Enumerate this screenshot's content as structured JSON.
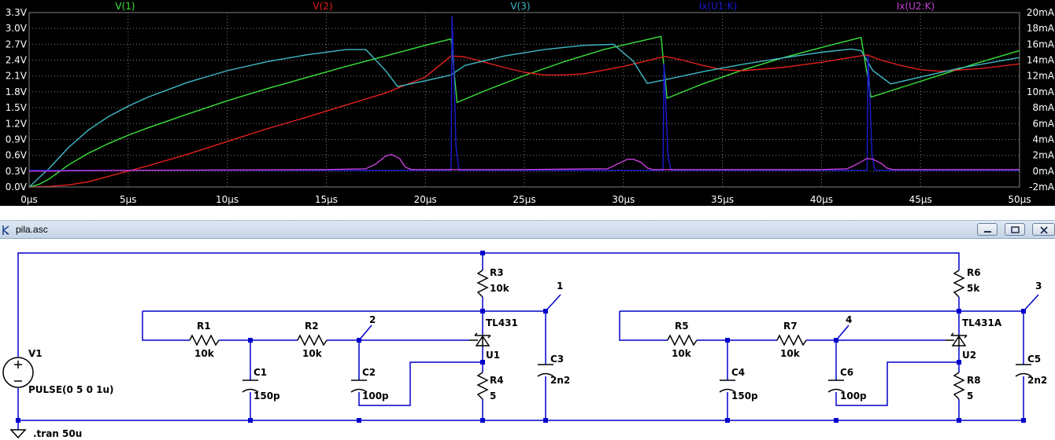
{
  "window_title": "pila.asc",
  "colors": {
    "plot_bg": "#000000",
    "grid": "#7f7f7f",
    "axis_text": "#ffffff",
    "v1": "#39e23a",
    "v2": "#e5201c",
    "v3": "#3fb9c9",
    "ix_u1k": "#1b1bd6",
    "ix_u2k": "#c43fd6",
    "wire": "#0000cc",
    "component": "#000000"
  },
  "chart_data": {
    "type": "line",
    "x_label": "",
    "xlim": [
      0,
      50
    ],
    "x_ticks": [
      "0µs",
      "5µs",
      "10µs",
      "15µs",
      "20µs",
      "25µs",
      "30µs",
      "35µs",
      "40µs",
      "45µs",
      "50µs"
    ],
    "y_left_lim": [
      0,
      3.3
    ],
    "y_left_ticks": [
      "3.3V",
      "3.0V",
      "2.7V",
      "2.4V",
      "2.1V",
      "1.8V",
      "1.5V",
      "1.2V",
      "0.9V",
      "0.6V",
      "0.3V",
      "0.0V"
    ],
    "y_right_lim": [
      -2,
      20
    ],
    "y_right_ticks": [
      "20mA",
      "18mA",
      "16mA",
      "14mA",
      "12mA",
      "10mA",
      "8mA",
      "6mA",
      "4mA",
      "2mA",
      "0mA",
      "-2mA"
    ],
    "grid": true,
    "series": [
      {
        "name": "V(1)",
        "axis": "left",
        "color": "#39e23a",
        "x": [
          0,
          0.5,
          1,
          2,
          3,
          4,
          5,
          6,
          8,
          10,
          12,
          14,
          16,
          18,
          20,
          21.3,
          21.6,
          23,
          25,
          27,
          29,
          31.9,
          32.2,
          34,
          36,
          38,
          40,
          42,
          42.5,
          44,
          46,
          48,
          50
        ],
        "y": [
          0,
          0.05,
          0.15,
          0.42,
          0.64,
          0.82,
          0.98,
          1.12,
          1.38,
          1.63,
          1.86,
          2.07,
          2.28,
          2.48,
          2.68,
          2.8,
          1.6,
          1.82,
          2.11,
          2.37,
          2.6,
          2.85,
          1.68,
          1.95,
          2.21,
          2.44,
          2.64,
          2.83,
          1.7,
          1.88,
          2.12,
          2.36,
          2.58
        ]
      },
      {
        "name": "V(2)",
        "axis": "left",
        "color": "#e5201c",
        "x": [
          0,
          1,
          2,
          3,
          4,
          5,
          6,
          8,
          10,
          12,
          14,
          16,
          18,
          20,
          21.3,
          22,
          23,
          24,
          25,
          26,
          27,
          28,
          30,
          32.1,
          33,
          34,
          35,
          36,
          38,
          40,
          42.3,
          43,
          44,
          45,
          46,
          48,
          50
        ],
        "y": [
          0,
          0.01,
          0.04,
          0.1,
          0.2,
          0.3,
          0.4,
          0.62,
          0.86,
          1.1,
          1.32,
          1.55,
          1.78,
          2.08,
          2.48,
          2.46,
          2.36,
          2.26,
          2.17,
          2.12,
          2.12,
          2.14,
          2.28,
          2.47,
          2.4,
          2.3,
          2.22,
          2.2,
          2.26,
          2.36,
          2.5,
          2.4,
          2.3,
          2.22,
          2.19,
          2.24,
          2.33
        ]
      },
      {
        "name": "V(3)",
        "axis": "left",
        "color": "#3fb9c9",
        "x": [
          0,
          1,
          2,
          3,
          4,
          5,
          6,
          8,
          10,
          12,
          14,
          16,
          17,
          18,
          18.6,
          20,
          21.3,
          22,
          24,
          26,
          28,
          29.5,
          30.5,
          31.2,
          32,
          34,
          36,
          38,
          40,
          41.5,
          42,
          42.6,
          43.5,
          45,
          47,
          50
        ],
        "y": [
          0,
          0.35,
          0.75,
          1.08,
          1.33,
          1.53,
          1.7,
          1.98,
          2.2,
          2.37,
          2.5,
          2.6,
          2.6,
          2.2,
          1.9,
          2.01,
          2.12,
          2.3,
          2.48,
          2.6,
          2.68,
          2.7,
          2.38,
          1.96,
          2.02,
          2.18,
          2.32,
          2.44,
          2.55,
          2.61,
          2.58,
          2.2,
          1.95,
          2.08,
          2.25,
          2.45
        ]
      },
      {
        "name": "Ix(U1:K)",
        "axis": "right",
        "color": "#1b1bd6",
        "x": [
          0,
          1,
          5,
          10,
          15,
          20,
          21.3,
          21.35,
          21.45,
          21.55,
          21.7,
          22,
          25,
          30,
          32.0,
          32.05,
          32.15,
          32.25,
          32.4,
          32.7,
          35,
          40,
          42.3,
          42.35,
          42.45,
          42.55,
          42.7,
          43,
          45,
          50
        ],
        "y": [
          0.1,
          0.1,
          0.1,
          0.1,
          0.1,
          0.1,
          0.1,
          19.5,
          12,
          3,
          0.1,
          0.1,
          0.1,
          0.1,
          0.1,
          13.5,
          8,
          2,
          0.1,
          0.1,
          0.1,
          0.1,
          0.1,
          14.5,
          9,
          2,
          0.1,
          0.1,
          0.1,
          0.1
        ]
      },
      {
        "name": "Ix(U2:K)",
        "axis": "right",
        "color": "#c43fd6",
        "x": [
          0,
          1,
          2,
          5,
          10,
          15,
          17,
          17.5,
          18,
          18.3,
          18.7,
          19.0,
          19.3,
          20,
          25,
          29.2,
          29.7,
          30.2,
          30.5,
          30.9,
          31.2,
          31.5,
          32,
          35,
          40,
          41.3,
          41.8,
          42.3,
          42.6,
          43.0,
          43.3,
          43.6,
          44,
          50
        ],
        "y": [
          0,
          0.0,
          0.05,
          0.1,
          0.15,
          0.2,
          0.3,
          0.9,
          1.9,
          2.1,
          1.6,
          0.5,
          0.2,
          0.2,
          0.2,
          0.3,
          0.9,
          1.5,
          1.5,
          1.1,
          0.4,
          0.2,
          0.2,
          0.2,
          0.2,
          0.3,
          0.9,
          1.6,
          1.5,
          1.0,
          0.4,
          0.2,
          0.2,
          0.2
        ]
      }
    ]
  },
  "schematic": {
    "labels": {
      "V1": "V1",
      "V1_value": "PULSE(0 5 0 1u)",
      "R1": "R1",
      "R1_value": "10k",
      "R2": "R2",
      "R2_value": "10k",
      "R3": "R3",
      "R3_value": "10k",
      "R4": "R4",
      "R4_value": "5",
      "C1": "C1",
      "C1_value": "150p",
      "C2": "C2",
      "C2_value": "100p",
      "C3": "C3",
      "C3_value": "2n2",
      "U1": "U1",
      "U1_type": "TL431",
      "R5": "R5",
      "R5_value": "10k",
      "R6": "R6",
      "R6_value": "5k",
      "R7": "R7",
      "R7_value": "10k",
      "R8": "R8",
      "R8_value": "5",
      "C4": "C4",
      "C4_value": "150p",
      "C5": "C5",
      "C5_value": "2n2",
      "C6": "C6",
      "C6_value": "100p",
      "U2": "U2",
      "U2_type": "TL431A",
      "net1": "1",
      "net2": "2",
      "net3": "3",
      "net4": "4",
      "directive": ".tran 50u"
    }
  }
}
